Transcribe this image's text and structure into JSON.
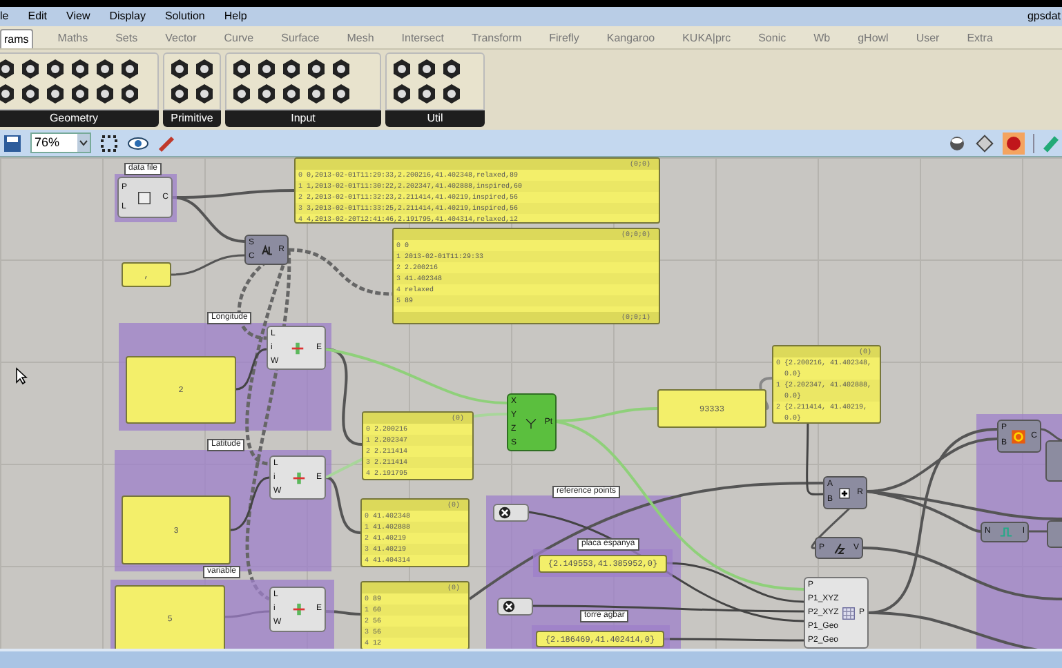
{
  "menu": [
    "le",
    "Edit",
    "View",
    "Display",
    "Solution",
    "Help"
  ],
  "doc_title": "gpsdat",
  "tabs": [
    {
      "label": "rams",
      "selected": true
    },
    {
      "label": "Maths",
      "selected": false
    },
    {
      "label": "Sets",
      "selected": false
    },
    {
      "label": "Vector",
      "selected": false
    },
    {
      "label": "Curve",
      "selected": false
    },
    {
      "label": "Surface",
      "selected": false
    },
    {
      "label": "Mesh",
      "selected": false
    },
    {
      "label": "Intersect",
      "selected": false
    },
    {
      "label": "Transform",
      "selected": false
    },
    {
      "label": "Firefly",
      "selected": false
    },
    {
      "label": "Kangaroo",
      "selected": false
    },
    {
      "label": "KUKA|prc",
      "selected": false
    },
    {
      "label": "Sonic",
      "selected": false
    },
    {
      "label": "Wb",
      "selected": false
    },
    {
      "label": "gHowl",
      "selected": false
    },
    {
      "label": "User",
      "selected": false
    },
    {
      "label": "Extra",
      "selected": false
    }
  ],
  "ribbon_groups": [
    "Geometry",
    "Primitive",
    "Input",
    "Util"
  ],
  "toolbar": {
    "zoom": "76%"
  },
  "canvas": {
    "groups": [
      {
        "label": "data file"
      },
      {
        "label": "Longitude"
      },
      {
        "label": "Latitude"
      },
      {
        "label": "variable"
      },
      {
        "label": "reference points"
      },
      {
        "label": "placa espanya"
      },
      {
        "label": "torre agbar"
      }
    ],
    "panels": [
      {
        "kind": "list",
        "header": "(0;0)",
        "rows": [
          [
            "0",
            "0,2013-02-01T11:29:33,2.200216,41.402348,relaxed,89"
          ],
          [
            "1",
            "1,2013-02-01T11:30:22,2.202347,41.402888,inspired,60"
          ],
          [
            "2",
            "2,2013-02-01T11:32:23,2.211414,41.40219,inspired,56"
          ],
          [
            "3",
            "3,2013-02-01T11:33:25,2.211414,41.40219,inspired,56"
          ],
          [
            "4",
            "4,2013-02-20T12:41:46,2.191795,41.404314,relaxed,12"
          ]
        ]
      },
      {
        "kind": "text",
        "text": ","
      },
      {
        "kind": "list",
        "header": "(0;0;0)",
        "footer": "(0;0;1)",
        "rows": [
          [
            "0",
            "0"
          ],
          [
            "1",
            "2013-02-01T11:29:33"
          ],
          [
            "2",
            "2.200216"
          ],
          [
            "3",
            "41.402348"
          ],
          [
            "4",
            "relaxed"
          ],
          [
            "5",
            "89"
          ]
        ]
      },
      {
        "kind": "text",
        "text": "2"
      },
      {
        "kind": "list",
        "header": "(0)",
        "rows": [
          [
            "0",
            "2.200216"
          ],
          [
            "1",
            "2.202347"
          ],
          [
            "2",
            "2.211414"
          ],
          [
            "3",
            "2.211414"
          ],
          [
            "4",
            "2.191795"
          ]
        ]
      },
      {
        "kind": "text",
        "text": "3"
      },
      {
        "kind": "list",
        "header": "(0)",
        "rows": [
          [
            "0",
            "41.402348"
          ],
          [
            "1",
            "41.402888"
          ],
          [
            "2",
            "41.40219"
          ],
          [
            "3",
            "41.40219"
          ],
          [
            "4",
            "41.404314"
          ]
        ]
      },
      {
        "kind": "text",
        "text": "5"
      },
      {
        "kind": "list",
        "header": "(0)",
        "rows": [
          [
            "0",
            "89"
          ],
          [
            "1",
            "60"
          ],
          [
            "2",
            "56"
          ],
          [
            "3",
            "56"
          ],
          [
            "4",
            "12"
          ]
        ]
      },
      {
        "kind": "text",
        "text": "93333"
      },
      {
        "kind": "list",
        "header": "(0)",
        "rows": [
          [
            "0",
            "{2.200216, 41.402348, 0.0}"
          ],
          [
            "1",
            "{2.202347, 41.402888, 0.0}"
          ],
          [
            "2",
            "{2.211414, 41.40219, 0.0}"
          ]
        ]
      },
      {
        "kind": "text",
        "text": "{2.149553,41.385952,0}"
      },
      {
        "kind": "text",
        "text": "{2.186469,41.402414,0}"
      }
    ],
    "components": [
      {
        "kind": "file",
        "inputs": [
          "P",
          "L"
        ],
        "outputs": [
          "C"
        ]
      },
      {
        "kind": "split",
        "inputs": [
          "S",
          "C"
        ],
        "outputs": [
          "R"
        ]
      },
      {
        "kind": "item",
        "inputs": [
          "L",
          "i",
          "W"
        ],
        "outputs": [
          "E"
        ]
      },
      {
        "kind": "item",
        "inputs": [
          "L",
          "i",
          "W"
        ],
        "outputs": [
          "E"
        ]
      },
      {
        "kind": "item",
        "inputs": [
          "L",
          "i",
          "W"
        ],
        "outputs": [
          "E"
        ]
      },
      {
        "kind": "xyz",
        "inputs": [
          "X",
          "Y",
          "Z",
          "S"
        ],
        "outputs": [
          "Pt"
        ]
      },
      {
        "kind": "addition",
        "inputs": [
          "A",
          "B"
        ],
        "outputs": [
          "R"
        ]
      },
      {
        "kind": "deconstruct",
        "inputs": [
          "P"
        ],
        "outputs": [
          "V"
        ]
      },
      {
        "kind": "custom",
        "inputs": [
          "P",
          "P1_XYZ",
          "P2_XYZ",
          "P1_Geo",
          "P2_Geo"
        ],
        "outputs": [
          "P"
        ]
      },
      {
        "kind": "circle",
        "inputs": [
          "P",
          "B"
        ],
        "outputs": [
          "C"
        ]
      },
      {
        "kind": "node",
        "inputs": [
          "N"
        ],
        "outputs": [
          "I"
        ]
      },
      {
        "kind": "point"
      },
      {
        "kind": "point"
      }
    ]
  }
}
